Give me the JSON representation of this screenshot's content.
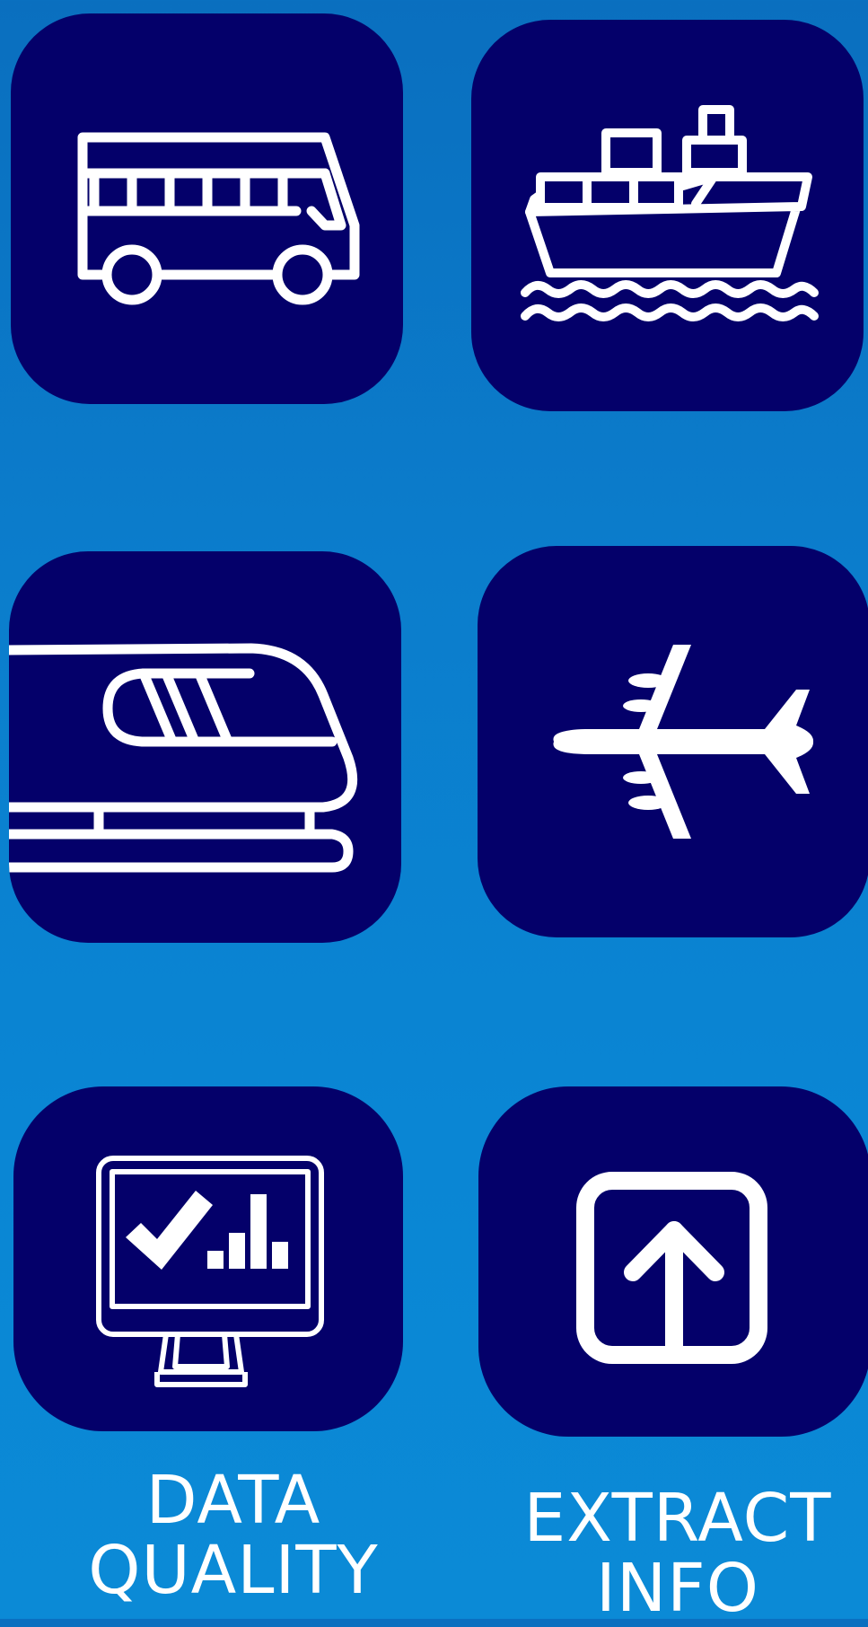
{
  "colors": {
    "background_top": "#0a6fbf",
    "background_bottom": "#0b8ad6",
    "tile": "#04006a",
    "icon": "#ffffff"
  },
  "tiles": [
    {
      "icon": "bus-icon"
    },
    {
      "icon": "cargo-ship-icon"
    },
    {
      "icon": "train-icon"
    },
    {
      "icon": "airplane-icon"
    },
    {
      "icon": "monitor-check-chart-icon"
    },
    {
      "icon": "upload-box-icon"
    }
  ],
  "captions": {
    "data_quality": {
      "line1": "DATA",
      "line2": "QUALITY"
    },
    "extract_info": {
      "line1": "EXTRACT",
      "line2": "INFO"
    }
  }
}
